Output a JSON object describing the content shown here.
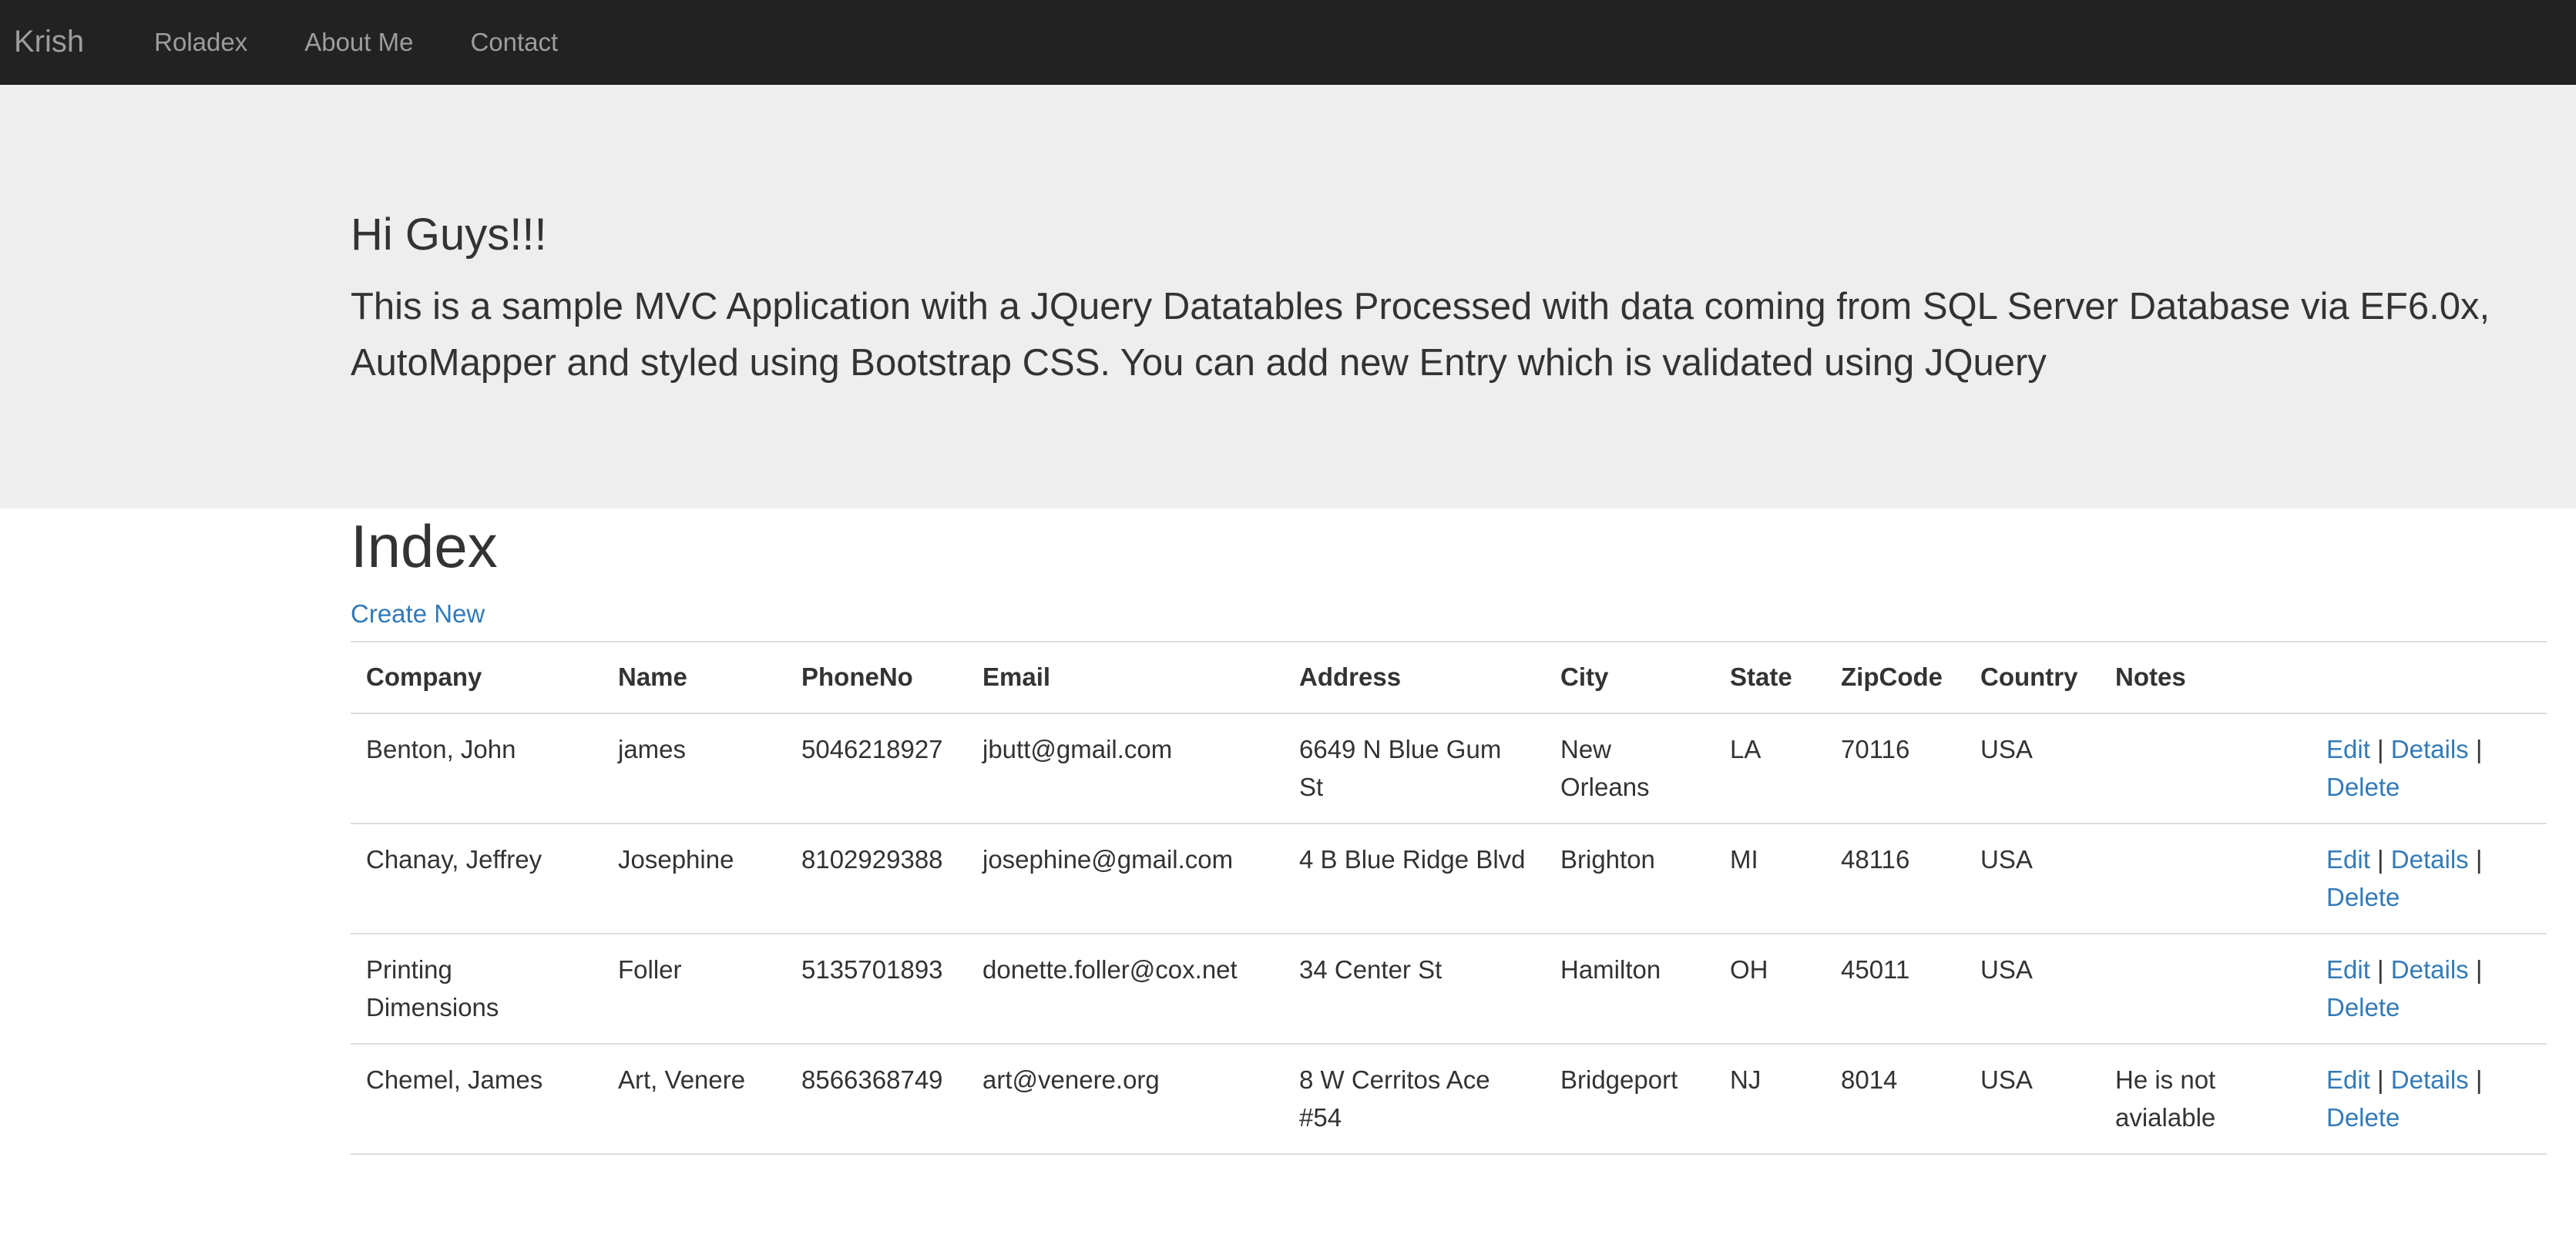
{
  "navbar": {
    "brand": "Krish",
    "links": [
      "Roladex",
      "About Me",
      "Contact"
    ]
  },
  "jumbotron": {
    "title": "Hi Guys!!!",
    "lead": "This is a sample MVC Application with a JQuery Datatables Processed with data coming from SQL Server Database via EF6.0x, AutoMapper and styled using Bootstrap CSS. You can add new Entry which is validated using JQuery"
  },
  "main": {
    "title": "Index",
    "create_label": "Create New",
    "table": {
      "headers": [
        "Company",
        "Name",
        "PhoneNo",
        "Email",
        "Address",
        "City",
        "State",
        "ZipCode",
        "Country",
        "Notes",
        ""
      ],
      "rows": [
        [
          "Benton, John",
          "james",
          "5046218927",
          "jbutt@gmail.com",
          "6649 N Blue Gum St",
          "New Orleans",
          "LA",
          "70116",
          "USA",
          ""
        ],
        [
          "Chanay, Jeffrey",
          "Josephine",
          "8102929388",
          "josephine@gmail.com",
          "4 B Blue Ridge Blvd",
          "Brighton",
          "MI",
          "48116",
          "USA",
          ""
        ],
        [
          "Printing Dimensions",
          "Foller",
          "5135701893",
          "donette.foller@cox.net",
          "34 Center St",
          "Hamilton",
          "OH",
          "45011",
          "USA",
          ""
        ],
        [
          "Chemel, James",
          "Art, Venere",
          "8566368749",
          "art@venere.org",
          "8 W Cerritos Ace #54",
          "Bridgeport",
          "NJ",
          "8014",
          "USA",
          "He is not avialable"
        ]
      ],
      "actions": {
        "edit": "Edit",
        "details": "Details",
        "delete": "Delete",
        "separator": "|"
      }
    }
  },
  "colors": {
    "navbar_bg": "#222222",
    "jumbotron_bg": "#eeeeee",
    "link": "#337ab7"
  }
}
